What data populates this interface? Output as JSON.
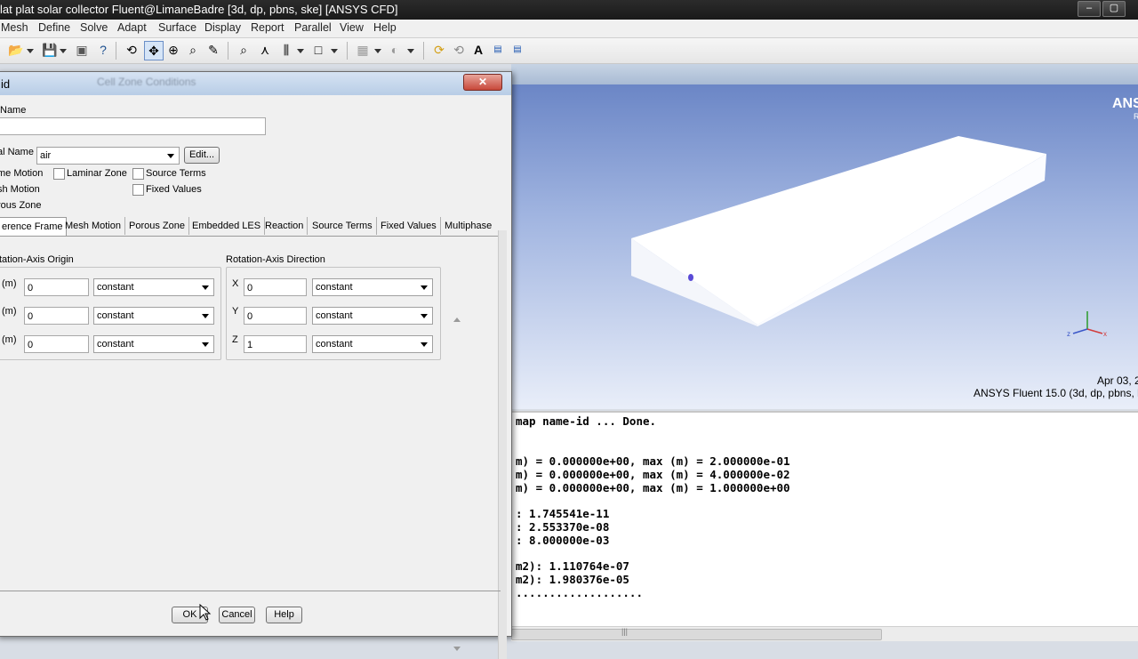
{
  "window": {
    "title": "lat plat solar collector Fluent@LimaneBadre  [3d, dp, pbns, ske] [ANSYS CFD]"
  },
  "menu": [
    "Mesh",
    "Define",
    "Solve",
    "Adapt",
    "Surface",
    "Display",
    "Report",
    "Parallel",
    "View",
    "Help"
  ],
  "viewport": {
    "brand": "ANSY",
    "brand_sub": "R",
    "date": "Apr 03, 2",
    "version": "ANSYS Fluent 15.0 (3d, dp, pbns, l"
  },
  "console": {
    "lines": [
      "map name-id ... Done.",
      "",
      "",
      "m) = 0.000000e+00, max (m) = 2.000000e-01",
      "m) = 0.000000e+00, max (m) = 4.000000e-02",
      "m) = 0.000000e+00, max (m) = 1.000000e+00",
      "",
      ": 1.745541e-11",
      ": 2.553370e-08",
      ": 8.000000e-03",
      "",
      "m2): 1.110764e-07",
      "m2): 1.980376e-05",
      "..................."
    ]
  },
  "dialog": {
    "title": "id",
    "ghost_title": "Cell Zone Conditions",
    "zone_name_label": "Name",
    "zone_name_value": "",
    "material_label": "al Name",
    "material_value": "air",
    "edit_label": "Edit...",
    "checks": {
      "frame_motion": "me Motion",
      "laminar_zone": "Laminar Zone",
      "source_terms": "Source Terms",
      "mesh_motion": "sh Motion",
      "fixed_values": "Fixed Values",
      "porous_zone": "rous Zone"
    },
    "tabs": [
      "erence Frame",
      "Mesh Motion",
      "Porous Zone",
      "Embedded LES",
      "Reaction",
      "Source Terms",
      "Fixed Values",
      "Multiphase"
    ],
    "origin": {
      "title": "tation-Axis Origin",
      "rows": [
        {
          "label": "(m)",
          "value": "0",
          "method": "constant"
        },
        {
          "label": "(m)",
          "value": "0",
          "method": "constant"
        },
        {
          "label": "(m)",
          "value": "0",
          "method": "constant"
        }
      ]
    },
    "direction": {
      "title": "Rotation-Axis Direction",
      "rows": [
        {
          "label": "X",
          "value": "0",
          "method": "constant"
        },
        {
          "label": "Y",
          "value": "0",
          "method": "constant"
        },
        {
          "label": "Z",
          "value": "1",
          "method": "constant"
        }
      ]
    },
    "ok_label": "OK",
    "cancel_label": "Cancel",
    "help_label": "Help"
  }
}
